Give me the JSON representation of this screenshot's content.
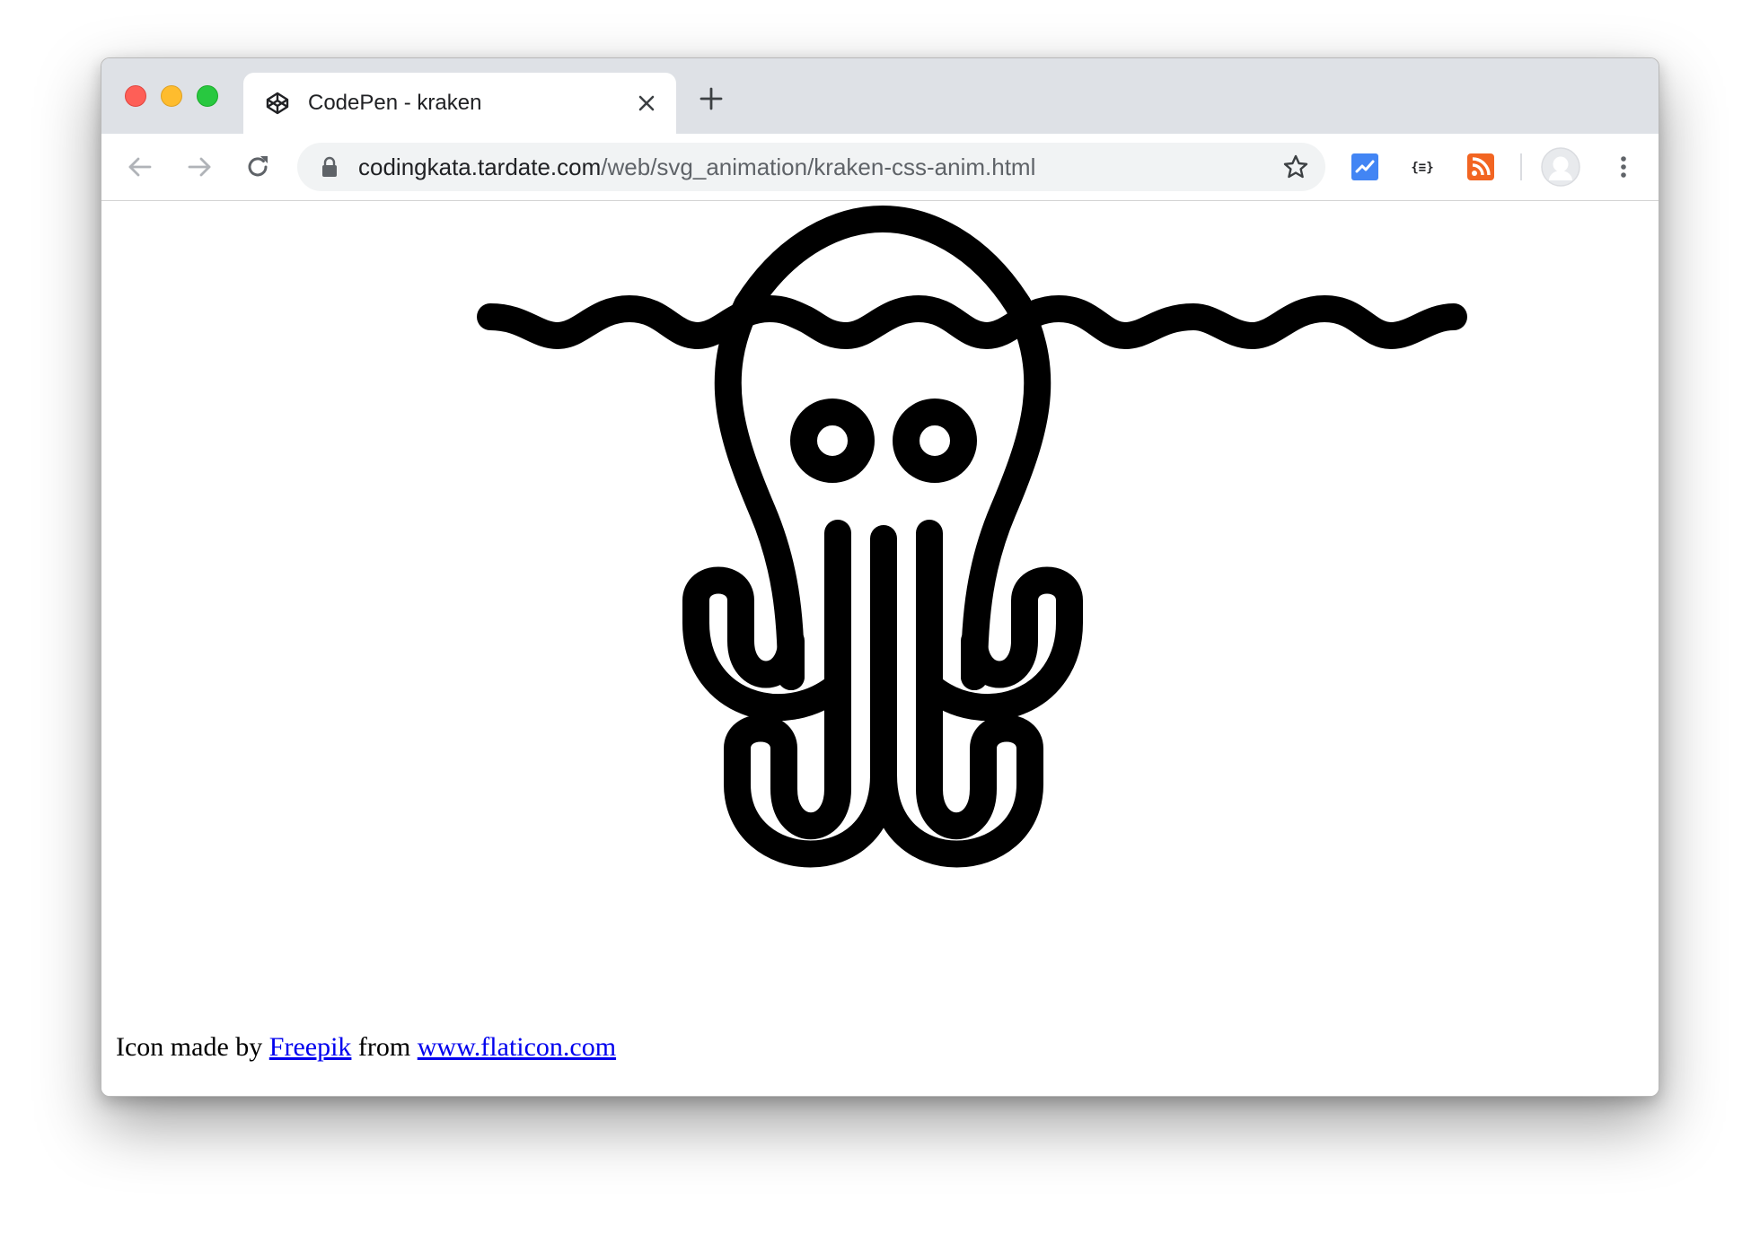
{
  "window": {
    "traffic_lights": [
      "close",
      "minimize",
      "maximize"
    ]
  },
  "tab": {
    "title": "CodePen - kraken",
    "favicon": "codepen-icon"
  },
  "toolbar": {
    "url_host": "codingkata.tardate.com",
    "url_path": "/web/svg_animation/kraken-css-anim.html",
    "extensions": [
      "chart-extension-icon",
      "json-viewer-icon",
      "rss-feed-icon"
    ]
  },
  "page": {
    "image": "kraken-octopus-icon",
    "credit": {
      "prefix": "Icon made by ",
      "author": "Freepik",
      "middle": " from ",
      "site": "www.flaticon.com"
    }
  },
  "colors": {
    "tabstrip": "#dee1e6",
    "omnibox": "#f1f3f4",
    "link": "#0000ee",
    "accent_extension": "#4285f4",
    "rss": "#f26522"
  }
}
